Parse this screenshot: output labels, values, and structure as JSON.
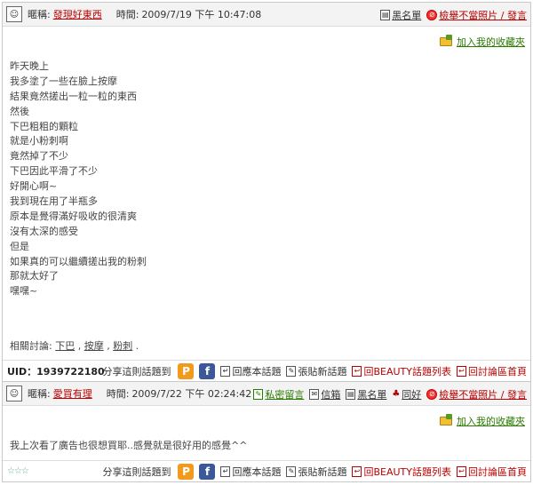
{
  "post1": {
    "nick_label": "暱稱:",
    "nick": "發現好東西",
    "time_label": "時間:",
    "time": "2009/7/19 下午 10:47:08",
    "blacklist": "黑名單",
    "report": "檢舉不當照片 / 發言",
    "fav": "加入我的收藏夾",
    "lines": [
      "昨天晚上",
      "我多塗了一些在臉上按摩",
      "結果竟然搓出一粒一粒的東西",
      "然後",
      "下巴粗粗的顆粒",
      "就是小粉刺啊",
      "竟然掉了不少",
      "下巴因此平滑了不少",
      "好開心啊~",
      "我到現在用了半瓶多",
      "原本是覺得滿好吸收的很清爽",
      "沒有太深的感受",
      "但是",
      "如果真的可以繼續搓出我的粉刺",
      "那就太好了",
      "嘿嘿~"
    ],
    "tags_label": "相關討論:",
    "tags": [
      "下巴",
      "按摩",
      "粉刺"
    ],
    "uid": "UID：1939722180"
  },
  "post2": {
    "nick_label": "暱稱:",
    "nick": "愛買有理",
    "time_label": "時間:",
    "time": "2009/7/22 下午 02:24:42",
    "pm": "私密留言",
    "mailbox": "信箱",
    "blacklist": "黑名單",
    "friend": "同好",
    "report": "檢舉不當照片 / 發言",
    "fav": "加入我的收藏夾",
    "text": "我上次看了廣告也很想買耶..感覺就是很好用的感覺^^",
    "stars": "☆☆☆"
  },
  "footer": {
    "share": "分享這則話題到",
    "reply": "回應本話題",
    "new_topic": "張貼新話題",
    "back_list": "回BEAUTY話題列表",
    "back_home": "回討論區首頁"
  }
}
